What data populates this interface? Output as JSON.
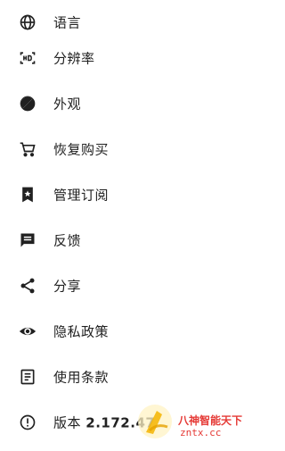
{
  "menu": {
    "items": [
      {
        "label": "语言",
        "icon": "globe-icon"
      },
      {
        "label": "分辨率",
        "icon": "hd-icon"
      },
      {
        "label": "外观",
        "icon": "contrast-icon"
      },
      {
        "label": "恢复购买",
        "icon": "cart-icon"
      },
      {
        "label": "管理订阅",
        "icon": "bookmark-star-icon"
      },
      {
        "label": "反馈",
        "icon": "feedback-icon"
      },
      {
        "label": "分享",
        "icon": "share-icon"
      },
      {
        "label": "隐私政策",
        "icon": "eye-icon"
      },
      {
        "label": "使用条款",
        "icon": "document-icon"
      },
      {
        "label": "版本",
        "version": "2.172.47",
        "icon": "info-icon"
      }
    ]
  },
  "watermark": {
    "line1": "八神智能天下",
    "line2": "zntx.cc",
    "color": "#e53935"
  },
  "colors": {
    "text": "#212121",
    "icon": "#212121",
    "background": "#ffffff"
  }
}
